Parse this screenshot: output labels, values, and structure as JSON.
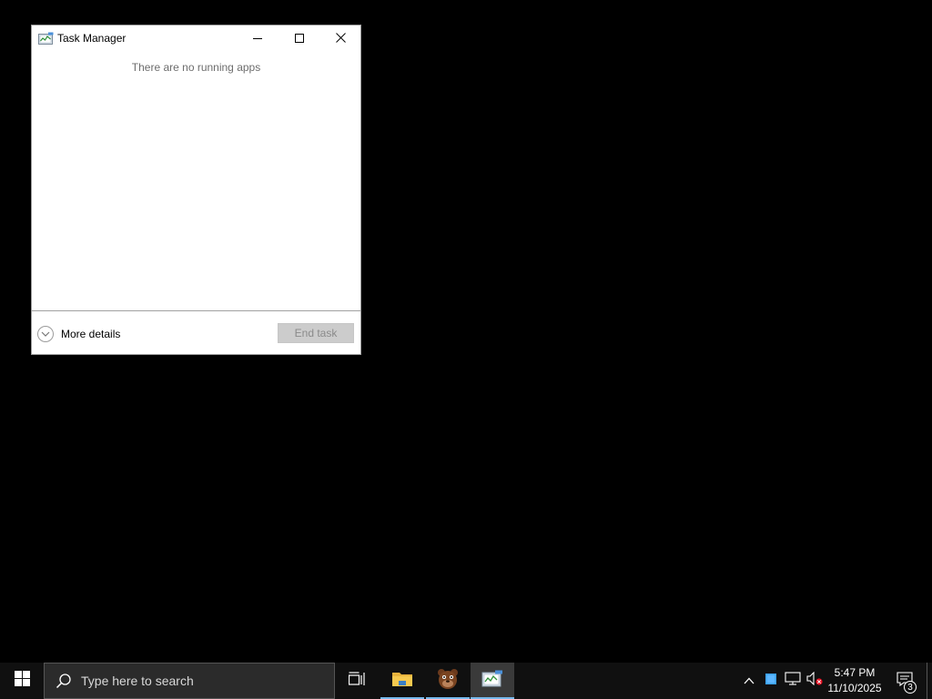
{
  "window": {
    "title": "Task Manager",
    "app_icon": "task-manager-icon",
    "controls": {
      "minimize": "minimize-icon",
      "maximize": "maximize-icon",
      "close": "close-icon"
    },
    "empty_message": "There are no running apps",
    "more_details_label": "More details",
    "end_task_label": "End task",
    "end_task_enabled": false
  },
  "taskbar": {
    "start_icon": "windows-logo-icon",
    "search": {
      "placeholder": "Type here to search",
      "icon": "search-icon"
    },
    "pinned": [
      {
        "name": "task-view",
        "icon": "task-view-icon",
        "running": false,
        "active": false
      },
      {
        "name": "file-explorer",
        "icon": "folder-icon",
        "running": true,
        "active": false
      },
      {
        "name": "game-app",
        "icon": "bear-app-icon",
        "running": true,
        "active": false
      },
      {
        "name": "task-manager",
        "icon": "task-manager-icon",
        "running": true,
        "active": true
      }
    ],
    "tray": {
      "icons": [
        "chevron-up-icon",
        "blue-square-app-icon",
        "network-icon",
        "volume-muted-icon"
      ],
      "time": "5:47 PM",
      "date": "11/10/2025",
      "notification_count": "3"
    }
  },
  "colors": {
    "desktop": "#000000",
    "taskbar": "#101010",
    "accent": "#76b9ed",
    "end_task_disabled_bg": "#cccccc"
  }
}
